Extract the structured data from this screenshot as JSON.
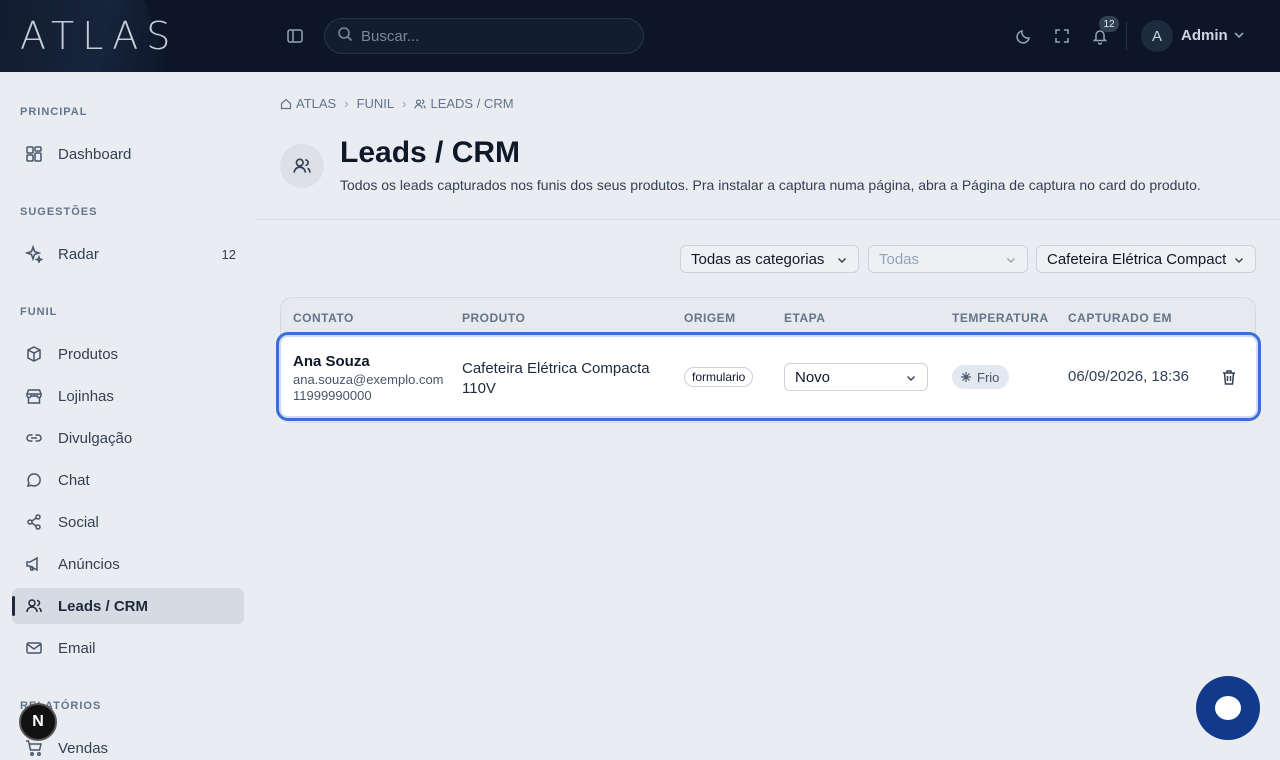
{
  "app": {
    "logo": "ATLAS"
  },
  "topbar": {
    "search_placeholder": "Buscar...",
    "notification_count": "12",
    "avatar_initial": "A",
    "user_name": "Admin"
  },
  "sidebar": {
    "sections": {
      "principal": "PRINCIPAL",
      "sugestoes": "SUGESTÕES",
      "funil": "FUNIL",
      "relatorios": "RELATÓRIOS"
    },
    "items": {
      "dashboard": "Dashboard",
      "radar": "Radar",
      "radar_count": "12",
      "produtos": "Produtos",
      "lojinhas": "Lojinhas",
      "divulgacao": "Divulgação",
      "chat": "Chat",
      "social": "Social",
      "anuncios": "Anúncios",
      "leads": "Leads / CRM",
      "email": "Email",
      "vendas": "Vendas"
    },
    "framework_badge": "N"
  },
  "breadcrumb": [
    "ATLAS",
    "FUNIL",
    "LEADS / CRM"
  ],
  "page": {
    "title": "Leads / CRM",
    "subtitle": "Todos os leads capturados nos funis dos seus produtos. Pra instalar a captura numa página, abra a Página de captura no card do produto."
  },
  "filters": {
    "category": "Todas as categorias",
    "subcategory": "Todas",
    "product": "Cafeteira Elétrica Compact"
  },
  "table": {
    "headers": [
      "CONTATO",
      "PRODUTO",
      "ORIGEM",
      "ETAPA",
      "TEMPERATURA",
      "CAPTURADO EM"
    ],
    "rows": [
      {
        "name": "Ana Souza",
        "email": "ana.souza@exemplo.com",
        "phone": "11999990000",
        "product": "Cafeteira Elétrica Compacta 110V",
        "origin": "formulario",
        "stage": "Novo",
        "temperature": "Frio",
        "captured_at": "06/09/2026, 18:36"
      }
    ]
  },
  "colors": {
    "topbar": "#0c1628",
    "accent": "#3b6fd8",
    "fab": "#123a8c"
  }
}
